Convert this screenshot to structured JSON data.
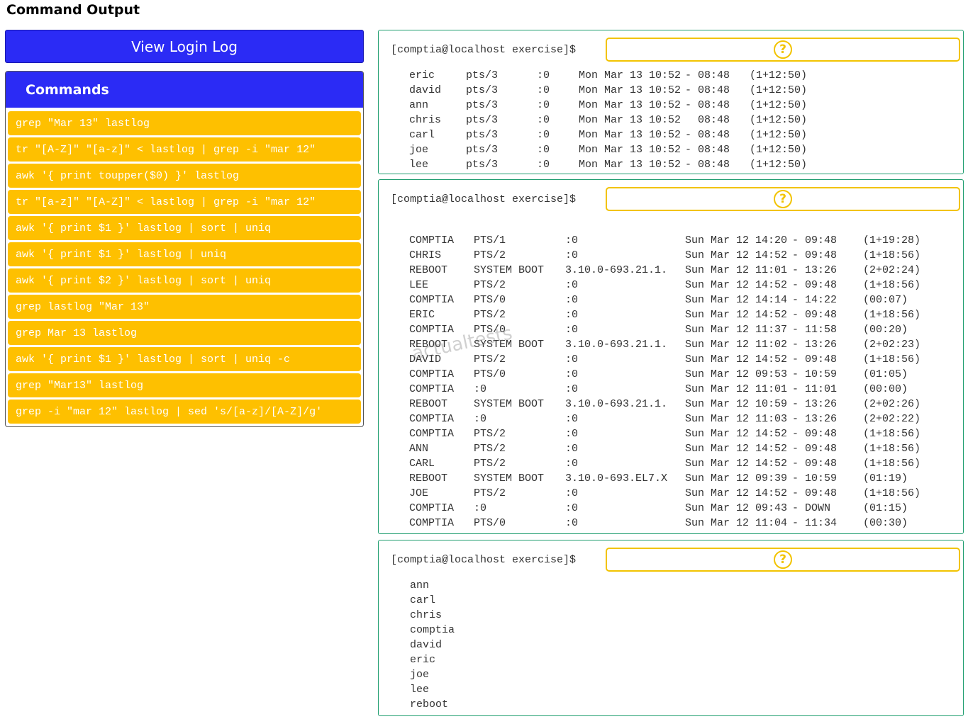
{
  "page": {
    "title": "Command Output"
  },
  "left": {
    "view_button": "View Login Log",
    "commands_title": "Commands",
    "commands": [
      "grep \"Mar 13\" lastlog",
      "tr \"[A-Z]\" \"[a-z]\" < lastlog | grep -i \"mar 12\"",
      "awk '{ print toupper($0) }' lastlog",
      "tr \"[a-z]\" \"[A-Z]\" < lastlog | grep -i \"mar 12\"",
      "awk '{ print $1 }' lastlog | sort | uniq",
      "awk '{ print $1 }' lastlog | uniq",
      "awk '{ print $2 }' lastlog | sort | uniq",
      "grep lastlog \"Mar 13\"",
      "grep Mar 13 lastlog",
      "awk '{ print $1 }' lastlog | sort | uniq -c",
      "grep \"Mar13\" lastlog",
      "grep -i \"mar 12\" lastlog | sed 's/[a-z]/[A-Z]/g'"
    ]
  },
  "terminals": [
    {
      "prompt": "[comptia@localhost exercise]$",
      "answer_icon": "?",
      "columns": [
        0,
        80,
        180,
        239,
        389,
        480
      ],
      "rows": [
        [
          "eric",
          "pts/3",
          ":0",
          "Mon Mar 13 10:52",
          "- 08:48",
          "(1+12:50)"
        ],
        [
          "david",
          "pts/3",
          ":0",
          "Mon Mar 13 10:52",
          "- 08:48",
          "(1+12:50)"
        ],
        [
          "ann",
          "pts/3",
          ":0",
          "Mon Mar 13 10:52",
          "- 08:48",
          "(1+12:50)"
        ],
        [
          "chris",
          "pts/3",
          ":0",
          "Mon Mar 13 10:52",
          "  08:48",
          "(1+12:50)"
        ],
        [
          "carl",
          "pts/3",
          ":0",
          "Mon Mar 13 10:52",
          "- 08:48",
          "(1+12:50)"
        ],
        [
          "joe",
          "pts/3",
          ":0",
          "Mon Mar 13 10:52",
          "- 08:48",
          "(1+12:50)"
        ],
        [
          "lee",
          "pts/3",
          ":0",
          "Mon Mar 13 10:52",
          "- 08:48",
          "(1+12:50)"
        ]
      ]
    },
    {
      "prompt": "[comptia@localhost exercise]$",
      "answer_icon": "?",
      "columns": [
        0,
        91,
        220,
        389,
        540,
        640
      ],
      "rows": [
        [
          "COMPTIA",
          "PTS/1",
          ":0",
          "Sun Mar 12 14:20",
          "- 09:48",
          "(1+19:28)"
        ],
        [
          "CHRIS",
          "PTS/2",
          ":0",
          "Sun Mar 12 14:52",
          "- 09:48",
          "(1+18:56)"
        ],
        [
          "REBOOT",
          "SYSTEM BOOT",
          "3.10.0-693.21.1.",
          "Sun Mar 12 11:01",
          "- 13:26",
          "(2+02:24)"
        ],
        [
          "LEE",
          "PTS/2",
          ":0",
          "Sun Mar 12 14:52",
          "- 09:48",
          "(1+18:56)"
        ],
        [
          "COMPTIA",
          "PTS/0",
          ":0",
          "Sun Mar 12 14:14",
          "- 14:22",
          "(00:07)"
        ],
        [
          "ERIC",
          "PTS/2",
          ":0",
          "Sun Mar 12 14:52",
          "- 09:48",
          "(1+18:56)"
        ],
        [
          "COMPTIA",
          "PTS/0",
          ":0",
          "Sun Mar 12 11:37",
          "- 11:58",
          "(00:20)"
        ],
        [
          "REBOOT",
          "SYSTEM BOOT",
          "3.10.0-693.21.1.",
          "Sun Mar 12 11:02",
          "- 13:26",
          "(2+02:23)"
        ],
        [
          "DAVID",
          "PTS/2",
          ":0",
          "Sun Mar 12 14:52",
          "- 09:48",
          "(1+18:56)"
        ],
        [
          "COMPTIA",
          "PTS/0",
          ":0",
          "Sun Mar 12 09:53",
          "- 10:59",
          "(01:05)"
        ],
        [
          "COMPTIA",
          ":0",
          ":0",
          "Sun Mar 12 11:01",
          "- 11:01",
          "(00:00)"
        ],
        [
          "REBOOT",
          "SYSTEM BOOT",
          "3.10.0-693.21.1.",
          "Sun Mar 12 10:59",
          "- 13:26",
          "(2+02:26)"
        ],
        [
          "COMPTIA",
          ":0",
          ":0",
          "Sun Mar 12 11:03",
          "- 13:26",
          "(2+02:22)"
        ],
        [
          "COMPTIA",
          "PTS/2",
          ":0",
          "Sun Mar 12 14:52",
          "- 09:48",
          "(1+18:56)"
        ],
        [
          "ANN",
          "PTS/2",
          ":0",
          "Sun Mar 12 14:52",
          "- 09:48",
          "(1+18:56)"
        ],
        [
          "CARL",
          "PTS/2",
          ":0",
          "Sun Mar 12 14:52",
          "- 09:48",
          "(1+18:56)"
        ],
        [
          "REBOOT",
          "SYSTEM BOOT",
          "3.10.0-693.EL7.X",
          "Sun Mar 12 09:39",
          "- 10:59",
          "(01:19)"
        ],
        [
          "JOE",
          "PTS/2",
          ":0",
          "Sun Mar 12 14:52",
          "- 09:48",
          "(1+18:56)"
        ],
        [
          "COMPTIA",
          ":0",
          ":0",
          "Sun Mar 12 09:43",
          "- DOWN",
          "(01:15)"
        ],
        [
          "COMPTIA",
          "PTS/0",
          ":0",
          "Sun Mar 12 11:04",
          "- 11:34",
          "(00:30)"
        ]
      ]
    },
    {
      "prompt": "[comptia@localhost exercise]$",
      "answer_icon": "?",
      "columns": [
        0
      ],
      "rows": [
        [
          "ann"
        ],
        [
          "carl"
        ],
        [
          "chris"
        ],
        [
          "comptia"
        ],
        [
          "david"
        ],
        [
          "eric"
        ],
        [
          "joe"
        ],
        [
          "lee"
        ],
        [
          "reboot"
        ]
      ]
    }
  ],
  "watermark": "actualtests"
}
